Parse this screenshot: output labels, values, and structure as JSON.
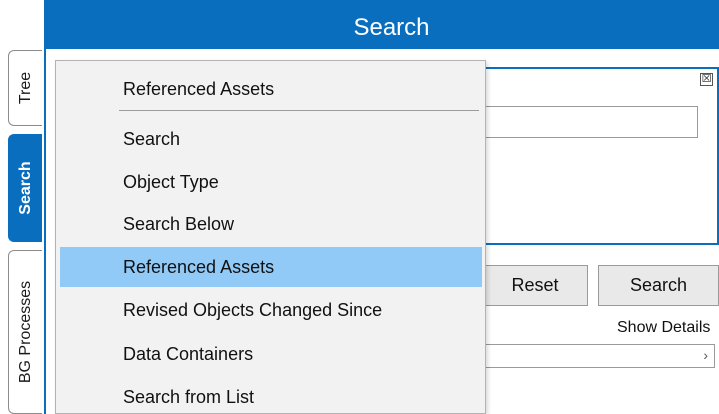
{
  "title_bar": {
    "title": "Search"
  },
  "side_tabs": [
    {
      "label": "Tree",
      "active": false
    },
    {
      "label": "Search",
      "active": true
    },
    {
      "label": "BG Processes",
      "active": false
    }
  ],
  "panel": {
    "close_glyph": "☒",
    "search_input_value": "",
    "reset_label": "Reset",
    "search_label": "Search",
    "show_details_label": "Show Details",
    "details_chevron": "›"
  },
  "menu": {
    "header": "Referenced Assets",
    "items": [
      {
        "label": "Search",
        "highlighted": false
      },
      {
        "label": "Object Type",
        "highlighted": false
      },
      {
        "label": "Search Below",
        "highlighted": false
      },
      {
        "label": "Referenced Assets",
        "highlighted": true
      },
      {
        "label": "Revised Objects Changed Since",
        "highlighted": false
      },
      {
        "label": "Data Containers",
        "highlighted": false
      },
      {
        "label": "Search from List",
        "highlighted": false
      }
    ]
  },
  "colors": {
    "accent": "#0a6ebf",
    "menu_background": "#f2f2f2",
    "menu_highlight": "#91c9f7"
  },
  "icons": {
    "close": "close-box-icon",
    "chevron": "chevron-right-icon"
  }
}
